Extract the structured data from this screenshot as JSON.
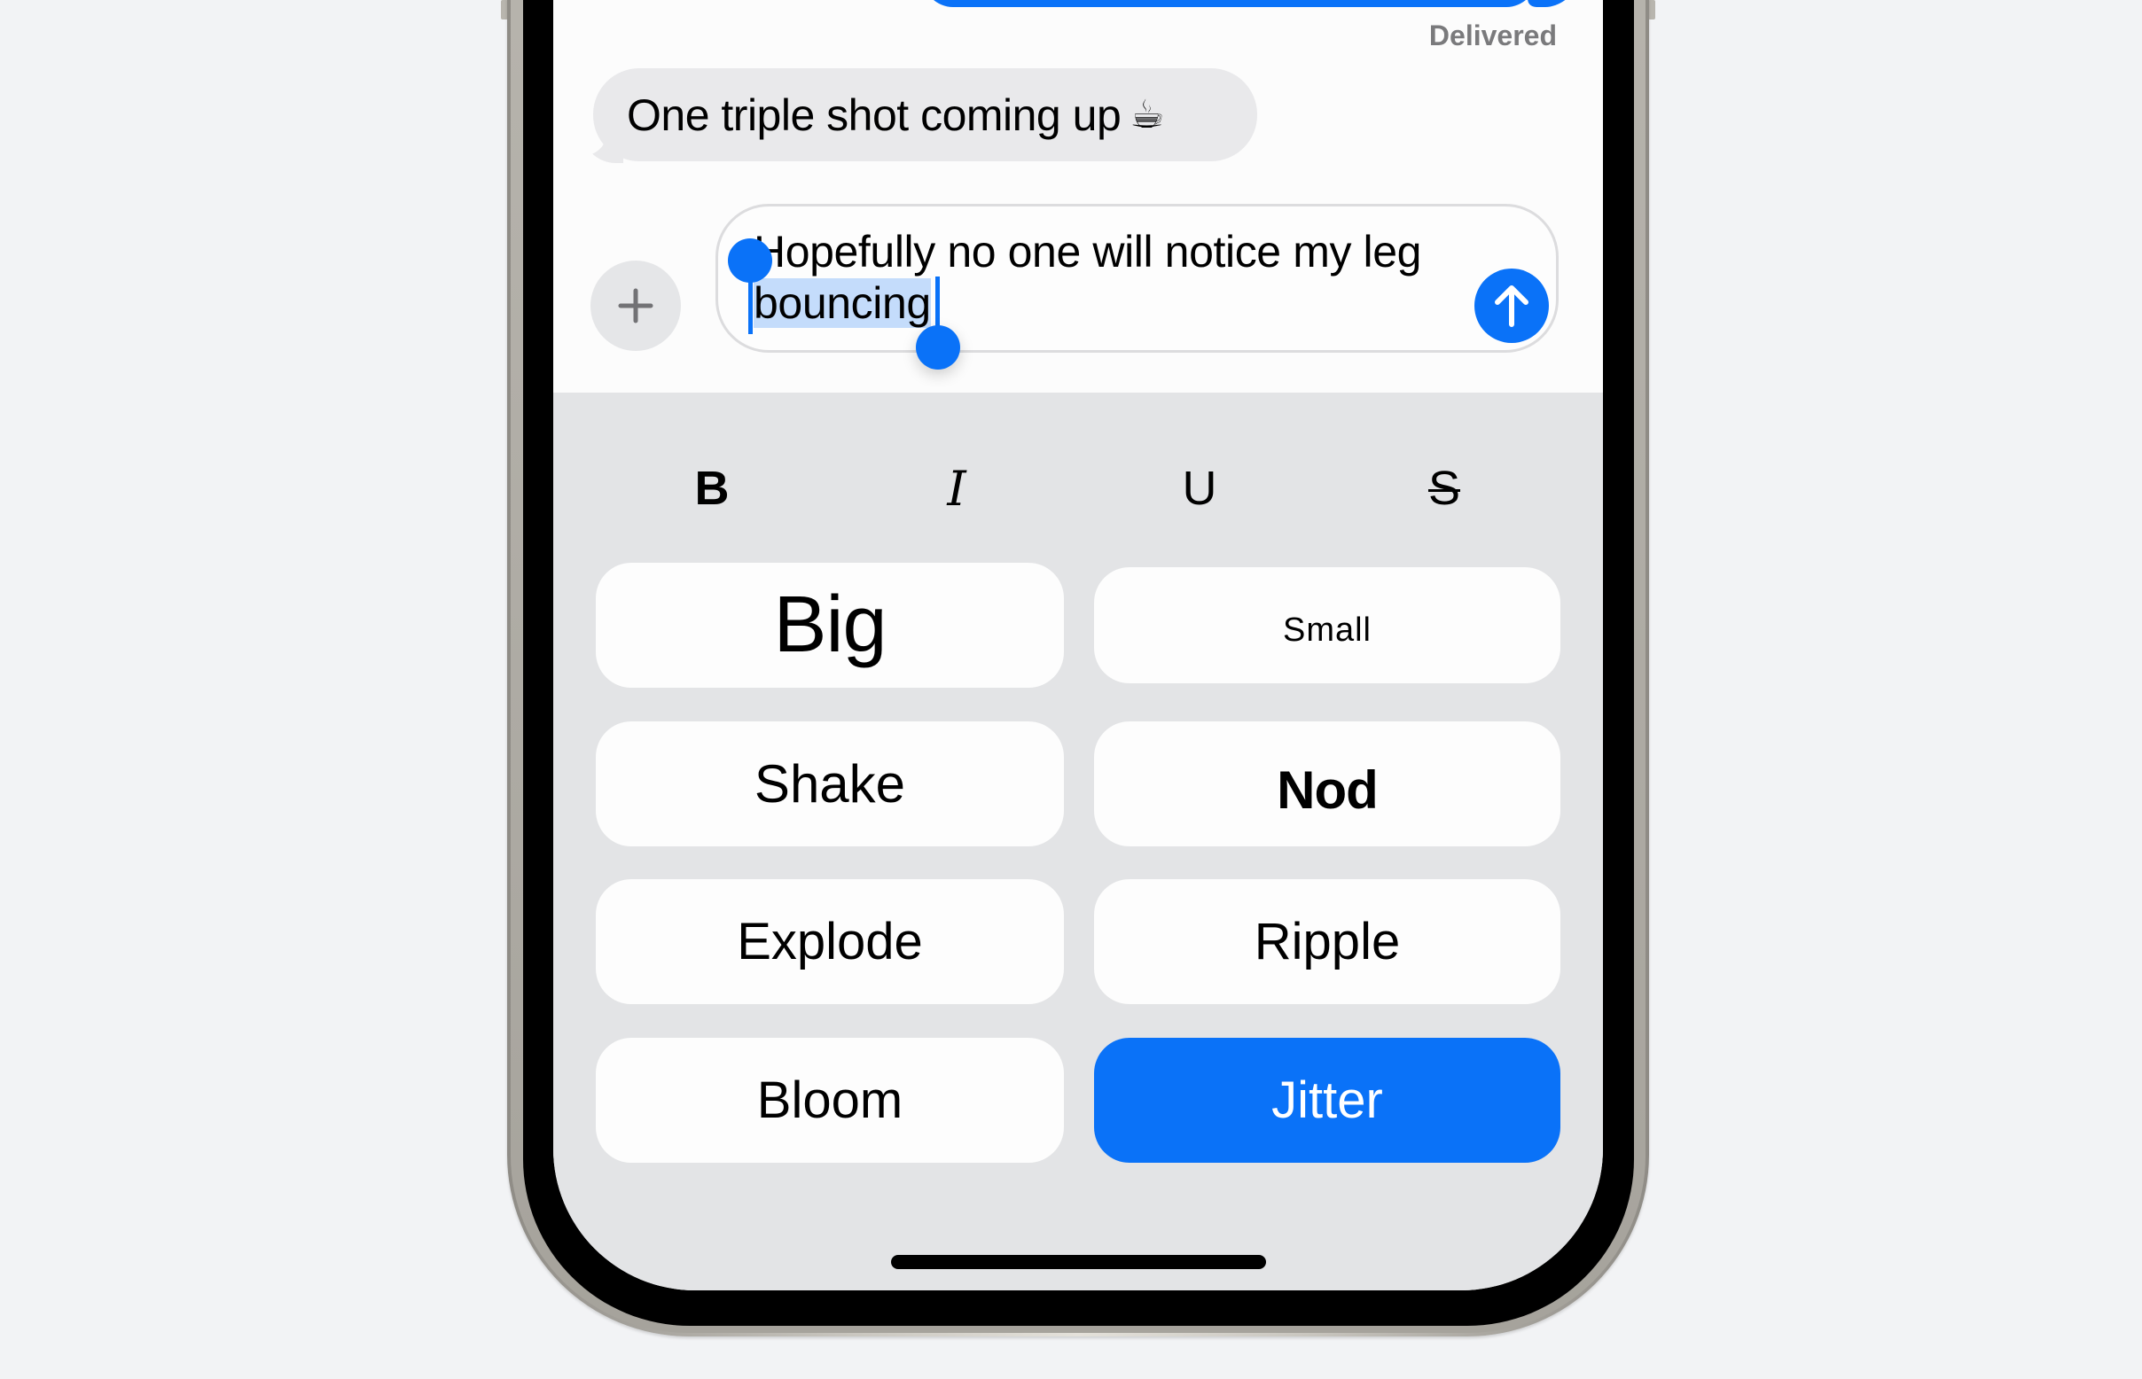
{
  "colors": {
    "accent": "#0a72f8",
    "background": "#f2f3f5",
    "panel": "#e3e4e6",
    "received_bubble": "#e9e9eb",
    "selection": "#c4dcfb"
  },
  "conversation": {
    "delivered_label": "Delivered",
    "received_message": {
      "text": "One triple shot coming up",
      "emoji": "☕"
    }
  },
  "composer": {
    "add_icon": "plus-icon",
    "text_before_selection": "Hopefully no one will notice my leg ",
    "selected_text": "bouncing",
    "send_icon": "arrow-up-icon"
  },
  "formatting": {
    "bold": "B",
    "italic": "I",
    "underline": "U",
    "strikethrough": "S"
  },
  "effects": [
    {
      "label": "Big",
      "selected": false
    },
    {
      "label": "Small",
      "selected": false
    },
    {
      "label": "Shake",
      "selected": false
    },
    {
      "label": "Nod",
      "selected": false
    },
    {
      "label": "Explode",
      "selected": false
    },
    {
      "label": "Ripple",
      "selected": false
    },
    {
      "label": "Bloom",
      "selected": false
    },
    {
      "label": "Jitter",
      "selected": true
    }
  ]
}
